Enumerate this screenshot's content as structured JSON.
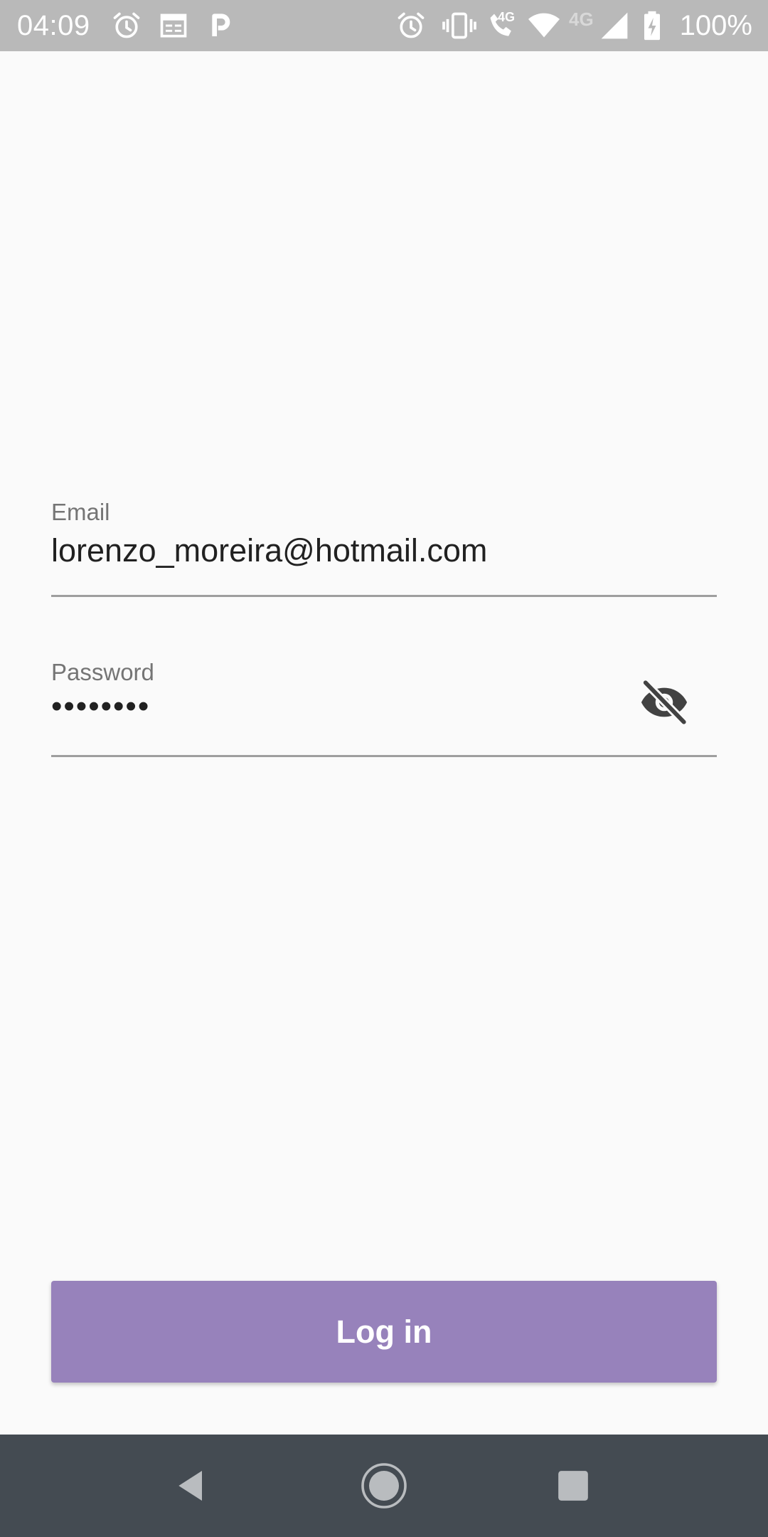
{
  "status_bar": {
    "time": "04:09",
    "battery_percent": "100%",
    "network_label": "4G",
    "left_icons": [
      "alarm-icon",
      "calendar-icon",
      "parking-icon"
    ],
    "right_icons": [
      "alarm-icon",
      "vibrate-icon",
      "wifi-calling-icon",
      "wifi-icon",
      "signal-icon",
      "battery-charging-icon"
    ]
  },
  "form": {
    "email": {
      "label": "Email",
      "value": "lorenzo_moreira@hotmail.com"
    },
    "password": {
      "label": "Password",
      "value": "••••••••",
      "toggle_icon": "visibility-off-icon"
    }
  },
  "login_button": {
    "label": "Log in"
  },
  "colors": {
    "status_bar_bg": "#b9b9b9",
    "page_bg": "#fafafa",
    "button_bg": "#9782bb",
    "nav_bar_bg": "#444b52"
  },
  "nav_bar": {
    "items": [
      "back-icon",
      "home-icon",
      "recents-icon"
    ]
  }
}
